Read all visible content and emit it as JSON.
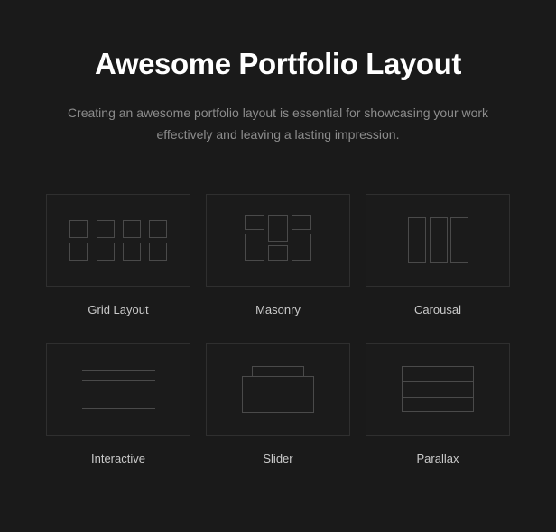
{
  "header": {
    "title": "Awesome Portfolio Layout",
    "subtitle": "Creating an awesome portfolio layout is essential for showcasing your work effectively and leaving a lasting impression."
  },
  "colors": {
    "page_background": "#1a1a1a",
    "outer_background": "#121212",
    "card_background": "#1b1b1b",
    "card_border": "#2f2f2f",
    "icon_stroke": "#4a4a4a",
    "title_text": "#ffffff",
    "subtitle_text": "#8c8c8c",
    "label_text": "#c9c9c9"
  },
  "cards": [
    {
      "label": "Grid Layout",
      "icon": "grid-layout-icon"
    },
    {
      "label": "Masonry",
      "icon": "masonry-icon"
    },
    {
      "label": "Carousal",
      "icon": "carousal-icon"
    },
    {
      "label": "Interactive",
      "icon": "interactive-icon"
    },
    {
      "label": "Slider",
      "icon": "slider-icon"
    },
    {
      "label": "Parallax",
      "icon": "parallax-icon"
    }
  ]
}
